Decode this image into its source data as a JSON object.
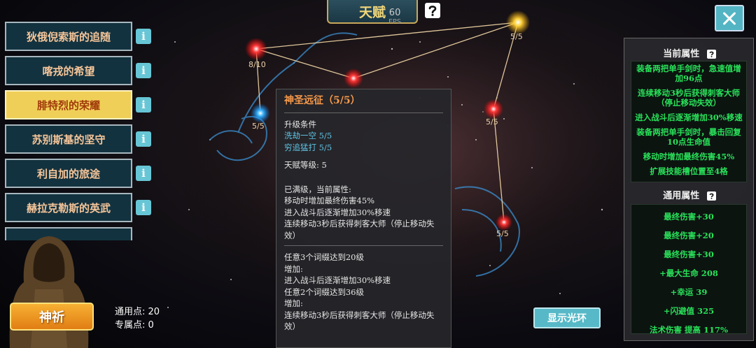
{
  "header": {
    "tab_title": "天赋",
    "fps_value": "60",
    "fps_unit": "FPS"
  },
  "talent_list": [
    {
      "label": "狄俄倪索斯的追随"
    },
    {
      "label": "喀戎的希望"
    },
    {
      "label": "腓特烈的荣耀",
      "active": true
    },
    {
      "label": "苏别斯基的坚守"
    },
    {
      "label": "利自加的旅途"
    },
    {
      "label": "赫拉克勒斯的英武"
    }
  ],
  "info_glyph": "i",
  "pray_button": "神祈",
  "points": {
    "general": "通用点: 20",
    "exclusive": "专属点: 0"
  },
  "constellation_nodes": [
    {
      "label": "8/10"
    },
    {
      "label": "5/5"
    },
    {
      "label": "5/5"
    },
    {
      "label": "5/5"
    },
    {
      "label": "5/5"
    }
  ],
  "tooltip": {
    "title": "神圣远征（5/5）",
    "req_header": "升级条件",
    "req_items": [
      "洗劫一空  5/5",
      "穷追猛打  5/5"
    ],
    "talent_level": "天赋等级:  5",
    "current_header": "已满级，当前属性:",
    "current_items": [
      "移动时增加最终伤害45%",
      "进入战斗后逐渐增加30%移速",
      "连续移动3秒后获得刺客大师（停止移动失效）"
    ],
    "bonus_lines": [
      "任意3个词缀达到20级",
      "增加:",
      "进入战斗后逐渐增加30%移速",
      "任意2个词缀达到36级",
      "增加:",
      "连续移动3秒后获得刺客大师（停止移动失效）"
    ]
  },
  "current_attrs": {
    "title": "当前属性",
    "items": [
      "装备两把单手剑时，急速值增加96点",
      "连续移动3秒后获得刺客大师（停止移动失效）",
      "进入战斗后逐渐增加30%移速",
      "装备两把单手剑时，暴击回复10点生命值",
      "移动时增加最终伤害45%",
      "扩展技能槽位置至4格"
    ]
  },
  "general_attrs": {
    "title": "通用属性",
    "items": [
      "最终伤害+30",
      "最终伤害+20",
      "最终伤害+30",
      "+最大生命  208",
      "+幸运  39",
      "+闪避值  325",
      "法术伤害 提高 117%"
    ]
  },
  "halo_button": "显示光环",
  "colors": {
    "accent_gold": "#f0cf58",
    "attr_green": "#29e25a",
    "title_orange": "#f79a4a",
    "link_blue": "#5fc5e6"
  }
}
